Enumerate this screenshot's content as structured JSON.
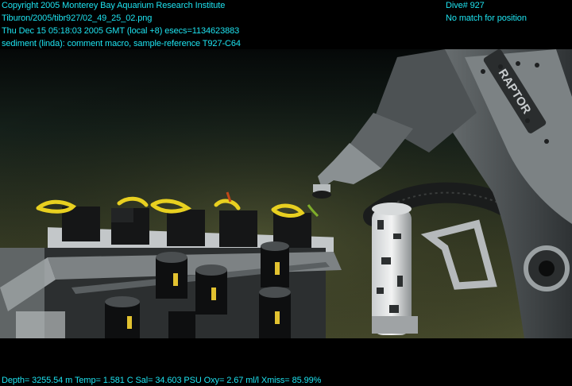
{
  "overlay": {
    "left_lines": [
      "Copyright 2005 Monterey Bay Aquarium Research Institute",
      "Tiburon/2005/tibr927/02_49_25_02.png",
      "Thu Dec 15 05:18:03 2005 GMT (local +8)  esecs=1134623883",
      "sediment (linda): comment macro, sample-reference T927-C64"
    ],
    "dive": "Dive# 927",
    "position_status": "No match for position",
    "sensor_line": "Depth= 3255.54 m  Temp= 1.581 C  Sal= 34.603 PSU  Oxy= 2.67 ml/l  Xmiss= 85.99%"
  },
  "arm_label": "RAPTOR",
  "colors": {
    "overlay_text": "#1ee3f0",
    "seafloor_far": "#15201a",
    "seafloor_near": "#4a4e2e",
    "rope_yellow": "#e8d020",
    "tube_label": "#e2c230"
  }
}
